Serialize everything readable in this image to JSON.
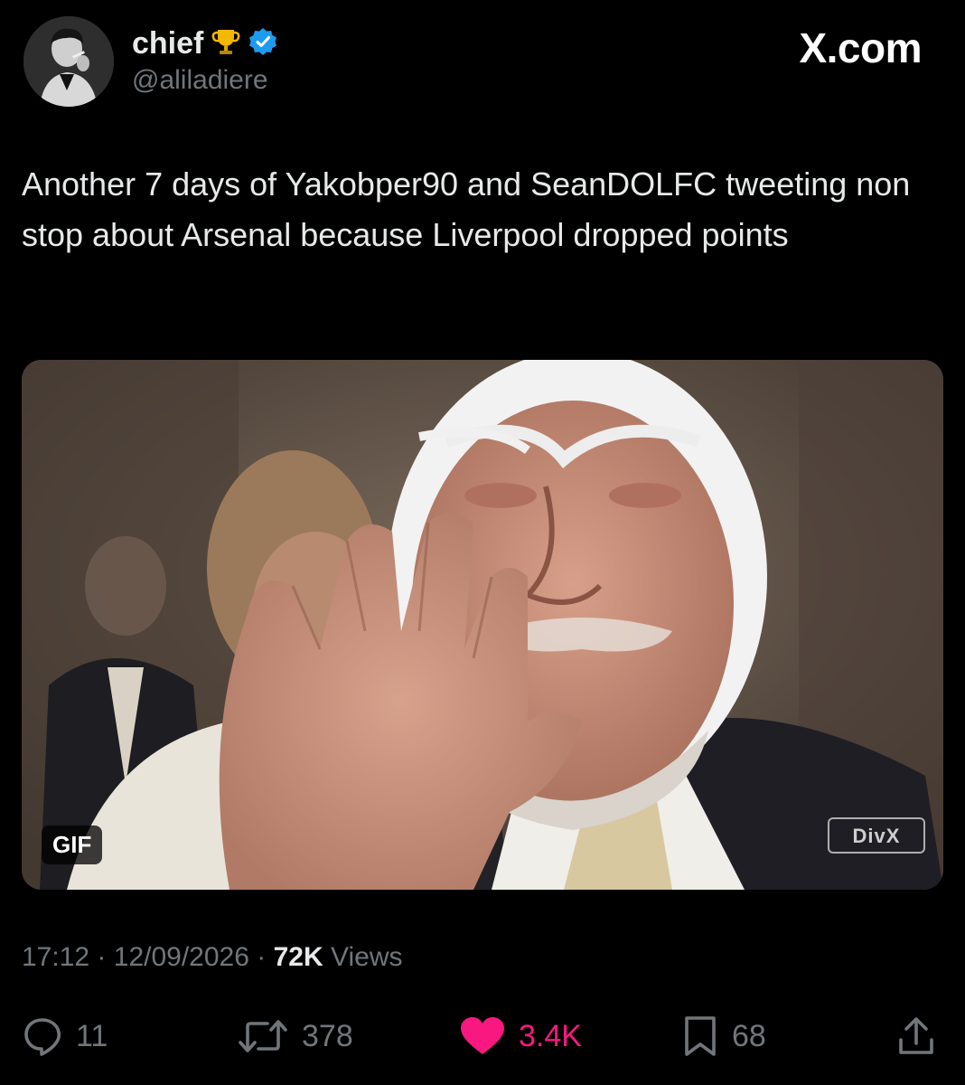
{
  "author": {
    "display_name": "chief",
    "name_emoji": "trophy",
    "verified_icon": "verified-badge-icon",
    "handle": "@aliladiere",
    "avatar": "black-and-white portrait of man lighting a cigarette"
  },
  "watermark": "X.com",
  "tweet": {
    "text": "Another 7 days of Yakobper90 and SeanDOLFC tweeting non stop about Arsenal because Liverpool dropped points"
  },
  "media": {
    "badge": "GIF",
    "overlay_logo": "DivX"
  },
  "meta": {
    "time": "17:12",
    "separator": "·",
    "date": "12/09/2026",
    "views_count": "72K",
    "views_label": "Views"
  },
  "actions": {
    "replies": "11",
    "reposts": "378",
    "likes": "3.4K",
    "bookmarks": "68"
  },
  "colors": {
    "background": "#000000",
    "text": "#e7e9ea",
    "muted": "#71767b",
    "like": "#f91880",
    "verified": "#1d9bf0",
    "trophy": "#f5b800"
  },
  "icons": [
    "reply-icon",
    "repost-icon",
    "like-heart-icon",
    "bookmark-icon",
    "share-icon",
    "verified-badge-icon",
    "trophy-icon"
  ]
}
